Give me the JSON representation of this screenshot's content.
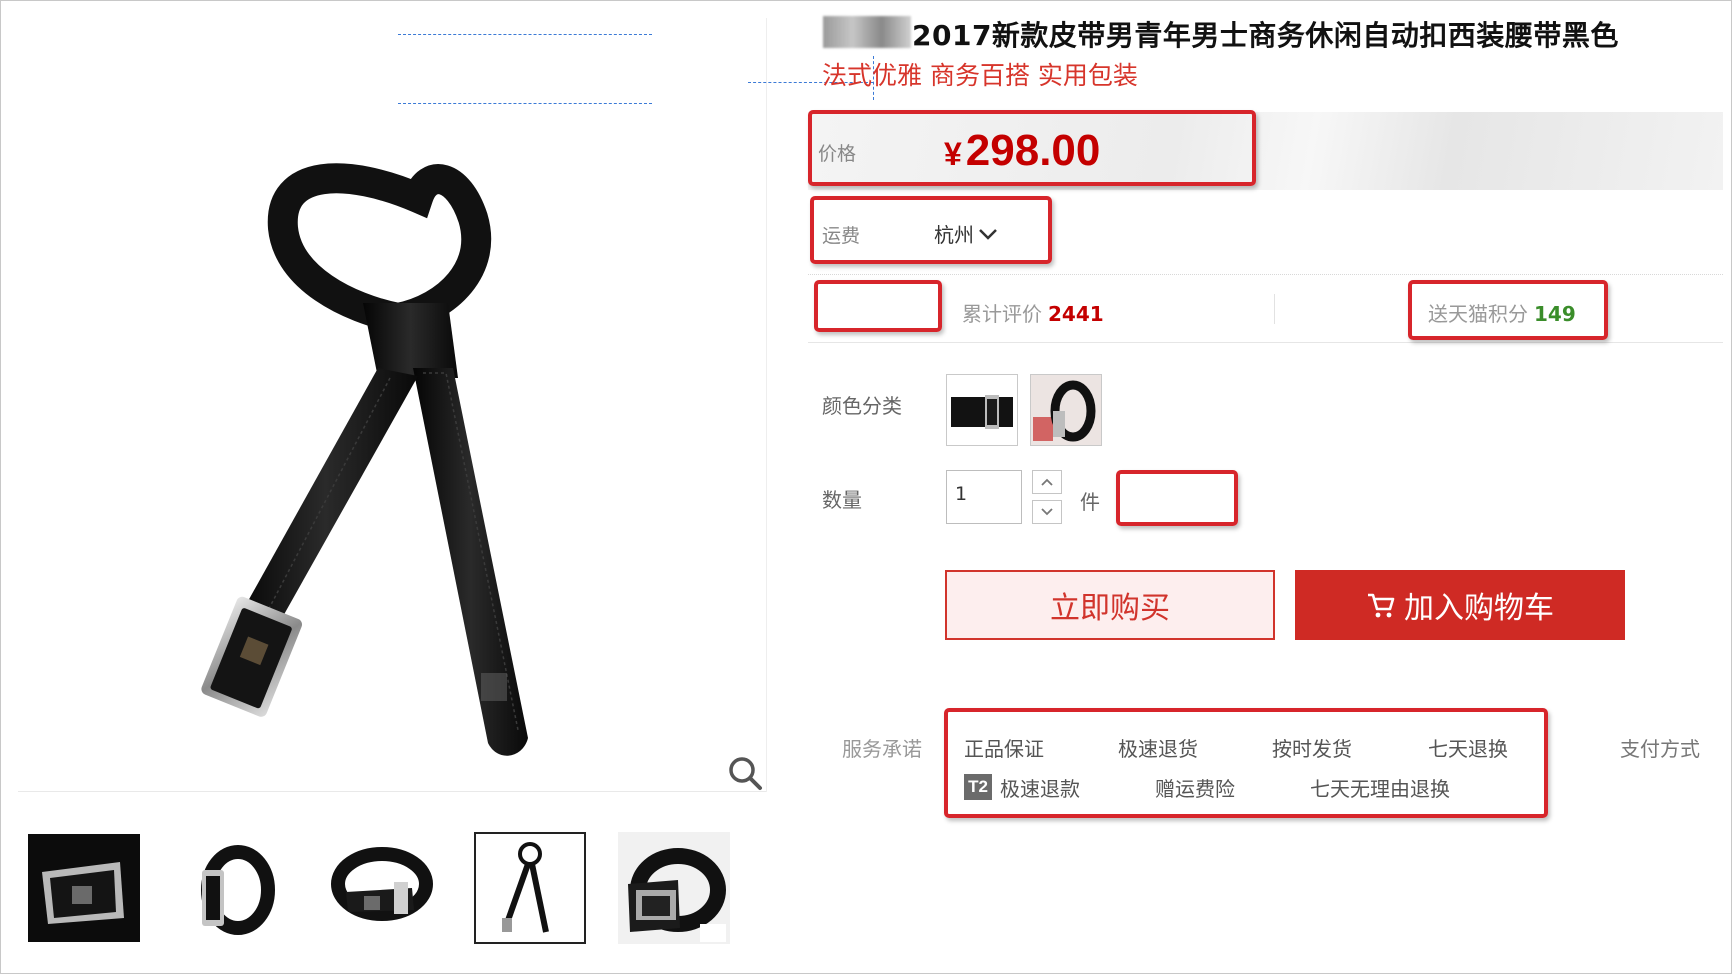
{
  "product": {
    "title": "2017新款皮带男青年男士商务休闲自动扣西装腰带黑色",
    "subtitle": "法式优雅 商务百搭 实用包装"
  },
  "price": {
    "label": "价格",
    "currency": "¥",
    "amount": "298.00"
  },
  "shipping": {
    "label": "运费",
    "location": "杭州"
  },
  "reviews": {
    "label": "累计评价",
    "count": "2441"
  },
  "points": {
    "label": "送天猫积分",
    "count": "149"
  },
  "options": {
    "color_label": "颜色分类"
  },
  "quantity": {
    "label": "数量",
    "value": "1",
    "unit": "件"
  },
  "actions": {
    "buy_now": "立即购买",
    "add_to_cart": "加入购物车"
  },
  "services": {
    "label": "服务承诺",
    "items_row1": [
      "正品保证",
      "极速退货",
      "按时发货",
      "七天退换"
    ],
    "badge": "T2",
    "items_row2": [
      "极速退款",
      "赠运费险",
      "七天无理由退换"
    ],
    "payment_label": "支付方式"
  },
  "icons": {
    "zoom": "magnifier-icon",
    "cart": "cart-icon",
    "dropdown": "chevron-down-icon",
    "stepper_up": "chevron-up-icon",
    "stepper_down": "chevron-down-icon"
  },
  "colors": {
    "brand_red": "#cf2a24",
    "price_red": "#c40000",
    "points_green": "#3a8d2a",
    "annotation_red": "#d7252b"
  }
}
